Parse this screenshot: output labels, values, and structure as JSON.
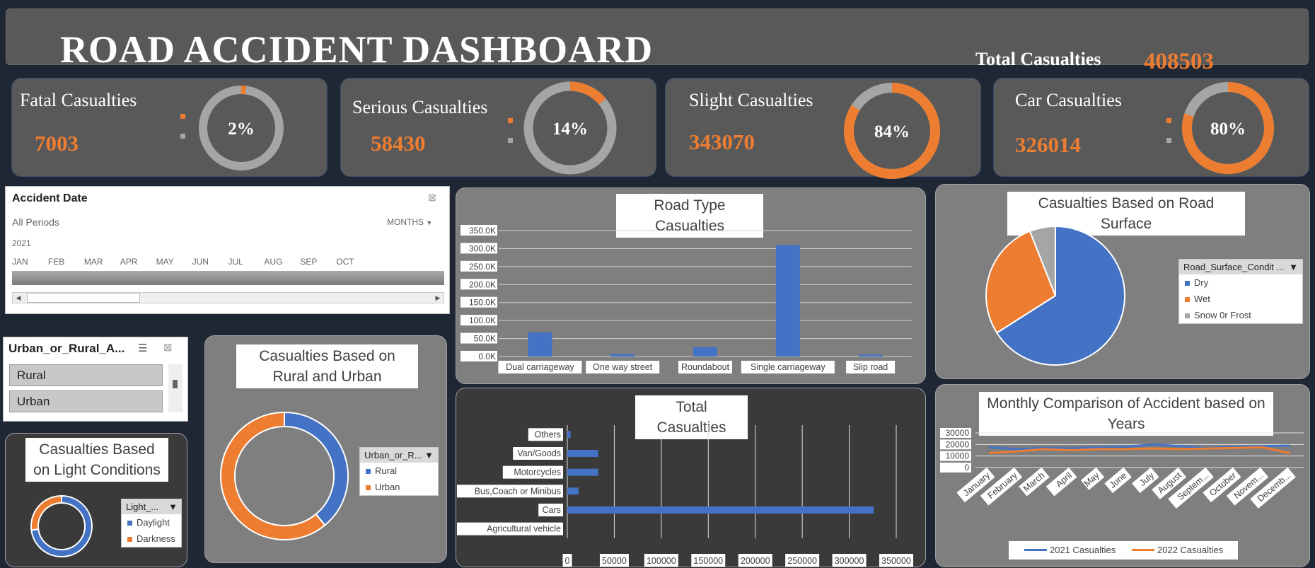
{
  "header": {
    "title": "ROAD ACCIDENT DASHBOARD",
    "total_label": "Total Casualties",
    "total_value": "408503"
  },
  "kpis": [
    {
      "label": "Fatal Casualties",
      "value": "7003",
      "percent_label": "2%",
      "percent": 0.02
    },
    {
      "label": "Serious Casualties",
      "value": "58430",
      "percent_label": "14%",
      "percent": 0.14
    },
    {
      "label": "Slight Casualties",
      "value": "343070",
      "percent_label": "84%",
      "percent": 0.84
    },
    {
      "label": "Car Casualties",
      "value": "326014",
      "percent_label": "80%",
      "percent": 0.8
    }
  ],
  "colors": {
    "accent": "#ed7d31",
    "blue": "#4472c4",
    "grey": "#a5a5a5",
    "panel": "#595959",
    "background": "#1f2735"
  },
  "timeline": {
    "title": "Accident Date",
    "period": "All Periods",
    "level": "MONTHS",
    "year": "2021",
    "months": [
      "JAN",
      "FEB",
      "MAR",
      "APR",
      "MAY",
      "JUN",
      "JUL",
      "AUG",
      "SEP",
      "OCT"
    ]
  },
  "slicer": {
    "title": "Urban_or_Rural_A...",
    "items": [
      "Rural",
      "Urban"
    ]
  },
  "chart_data": [
    {
      "type": "bar",
      "title": "Road Type Casualties",
      "categories": [
        "Dual carriageway",
        "One way street",
        "Roundabout",
        "Single carriageway",
        "Slip road"
      ],
      "values": [
        67000,
        7000,
        26000,
        310000,
        5000
      ],
      "ylim": [
        0,
        350000
      ],
      "y_ticks": [
        "0.0K",
        "50.0K",
        "100.0K",
        "150.0K",
        "200.0K",
        "250.0K",
        "300.0K",
        "350.0K"
      ],
      "grid": true
    },
    {
      "type": "pie",
      "title": "Casualties Based on Road Surface",
      "legend_title": "Road_Surface_Condit ...",
      "categories": [
        "Dry",
        "Wet",
        "Snow 0r Frost"
      ],
      "values": [
        66,
        28,
        6
      ],
      "colors": [
        "#4472c4",
        "#ed7d31",
        "#a5a5a5"
      ],
      "legend": "right"
    },
    {
      "type": "bar",
      "orientation": "horizontal",
      "title": "Total Casualties",
      "categories": [
        "Others",
        "Van/Goods",
        "Motorcycles",
        "Bus,Coach or Minibus",
        "Cars",
        "Agricultural vehicle"
      ],
      "values": [
        3500,
        33000,
        33000,
        12000,
        326014,
        0
      ],
      "xlim": [
        0,
        350000
      ],
      "x_ticks": [
        "0",
        "50000",
        "100000",
        "150000",
        "200000",
        "250000",
        "300000",
        "350000"
      ],
      "grid": true
    },
    {
      "type": "pie",
      "title": "Casualties Based on Rural and Urban",
      "donut": true,
      "legend_title": "Urban_or_R...",
      "categories": [
        "Rural",
        "Urban"
      ],
      "values": [
        39,
        61
      ],
      "colors": [
        "#4472c4",
        "#ed7d31"
      ],
      "legend": "right"
    },
    {
      "type": "pie",
      "title": "Casualties Based on Light Conditions",
      "donut": true,
      "legend_title": "Light_...",
      "categories": [
        "Daylight",
        "Darkness"
      ],
      "values": [
        73,
        27
      ],
      "colors": [
        "#4472c4",
        "#ed7d31"
      ],
      "legend": "right"
    },
    {
      "type": "line",
      "title": "Monthly Comparison of Accident based on Years",
      "categories": [
        "January",
        "February",
        "March",
        "April",
        "May",
        "June",
        "July",
        "August",
        "Septem...",
        "October",
        "Novem...",
        "Decemb..."
      ],
      "series": [
        {
          "name": "2021 Casualties",
          "values": [
            17500,
            16000,
            17000,
            16500,
            17500,
            18000,
            20000,
            18500,
            17000,
            18000,
            18500,
            19000
          ]
        },
        {
          "name": "2022 Casualties",
          "values": [
            12500,
            14000,
            16000,
            15000,
            16000,
            16000,
            16500,
            16000,
            16500,
            17000,
            17500,
            12500
          ]
        }
      ],
      "ylim": [
        0,
        30000
      ],
      "y_ticks": [
        "0",
        "10000",
        "20000",
        "30000"
      ],
      "legend": "bottom"
    }
  ]
}
